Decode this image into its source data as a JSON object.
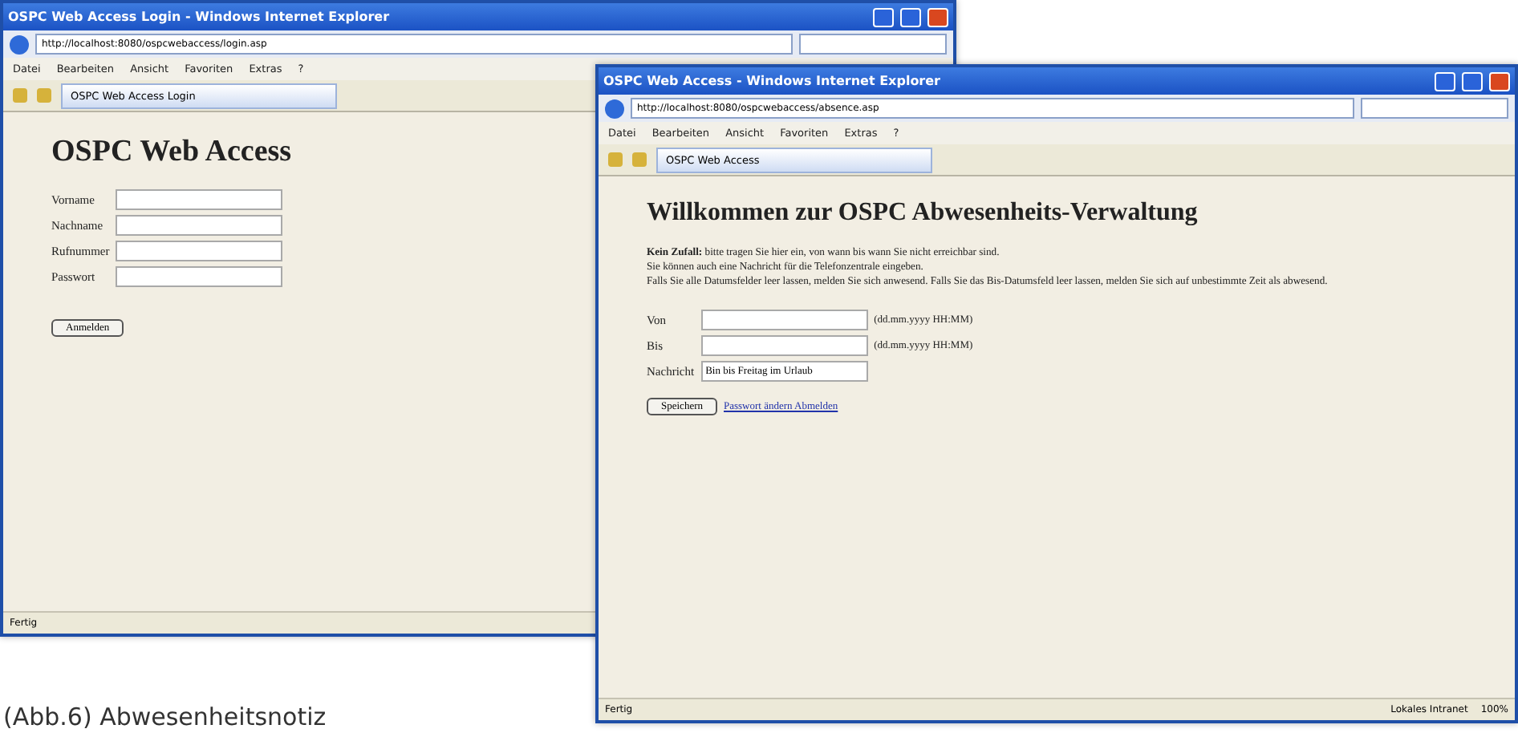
{
  "windows": [
    {
      "title": "OSPC Web Access Login - Windows Internet Explorer",
      "address": "http://localhost:8080/ospcwebaccess/login.asp",
      "menu": [
        "Datei",
        "Bearbeiten",
        "Ansicht",
        "Favoriten",
        "Extras",
        "?"
      ],
      "tab": "OSPC Web Access Login",
      "status": "Fertig",
      "page": {
        "kind": "login",
        "heading": "OSPC Web Access",
        "fields": [
          {
            "label": "Vorname"
          },
          {
            "label": "Nachname"
          },
          {
            "label": "Rufnummer"
          },
          {
            "label": "Passwort"
          }
        ],
        "button": "Anmelden"
      }
    },
    {
      "title": "OSPC Web Access - Windows Internet Explorer",
      "address": "http://localhost:8080/ospcwebaccess/absence.asp",
      "menu": [
        "Datei",
        "Bearbeiten",
        "Ansicht",
        "Favoriten",
        "Extras",
        "?"
      ],
      "tab": "OSPC Web Access",
      "status": "Fertig",
      "zone": "Lokales Intranet",
      "zoom": "100%",
      "page": {
        "kind": "absence",
        "heading": "Willkommen zur OSPC Abwesenheits-Verwaltung",
        "lines": [
          "**Kein Zufall:** bitte tragen Sie hier ein, von wann bis wann Sie nicht erreichbar sind.",
          "Sie können auch eine Nachricht für die Telefonzentrale eingeben.",
          "Falls Sie alle Datumsfelder leer lassen, melden Sie sich anwesend. Falls Sie das Bis-Datumsfeld leer lassen, melden Sie sich auf unbestimmte Zeit als abwesend."
        ],
        "fields": [
          {
            "label": "Von",
            "hint": "(dd.mm.yyyy HH:MM)"
          },
          {
            "label": "Bis",
            "hint": "(dd.mm.yyyy HH:MM)"
          },
          {
            "label": "Nachricht",
            "value": "Bin bis Freitag im Urlaub"
          }
        ],
        "button": "Speichern",
        "link": "Passwort ändern Abmelden"
      }
    }
  ],
  "caption": "(Abb.6) Abwesenheitsnotiz"
}
